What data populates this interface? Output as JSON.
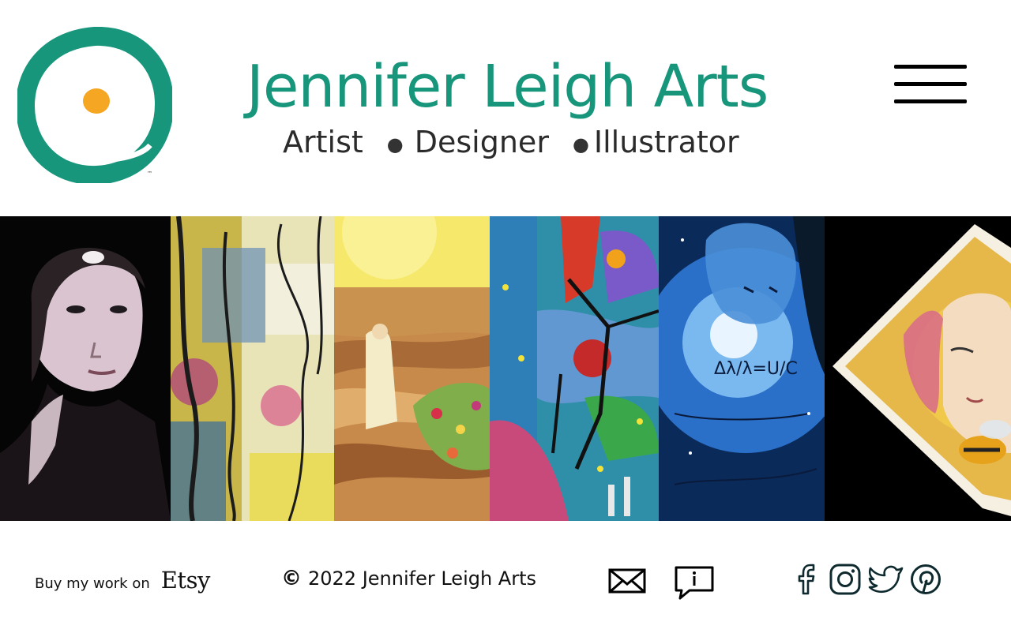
{
  "header": {
    "title": "Jennifer Leigh Arts",
    "taglines": [
      "Artist",
      "Designer",
      "Illustrator"
    ],
    "logo_icon": "ink-circle-logo",
    "trademark": "™",
    "menu_icon": "hamburger-menu-icon"
  },
  "gallery": {
    "panels": [
      "artist-portrait",
      "abstract-face-painting",
      "desert-figure-painting",
      "colorful-abstract-painting",
      "blue-equations-portrait",
      "honeycomb-bee-tile"
    ]
  },
  "footer": {
    "etsy_text": "Buy my work on",
    "etsy_logo": "Etsy",
    "copyright_symbol": "©",
    "copyright_text": "2022 Jennifer Leigh Arts",
    "icons": [
      "mail-icon",
      "info-chat-icon",
      "facebook-icon",
      "instagram-icon",
      "twitter-icon",
      "pinterest-icon"
    ]
  },
  "colors": {
    "brand_green": "#17967c",
    "logo_orange": "#f5a623",
    "icon_dark": "#0e2a2e"
  }
}
